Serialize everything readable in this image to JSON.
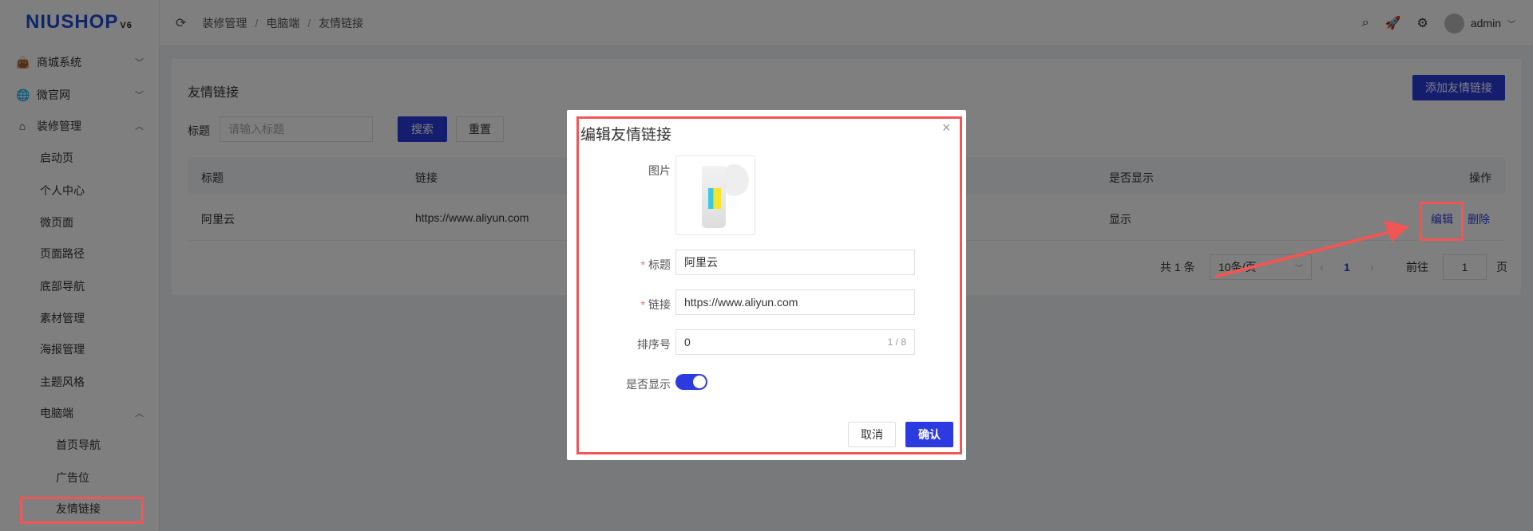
{
  "logo": {
    "text": "NIUSHOP",
    "version": "V6"
  },
  "sidebar": {
    "items": [
      {
        "label": "商城系统",
        "icon": "bag-icon",
        "expanded": false
      },
      {
        "label": "微官网",
        "icon": "globe-icon",
        "expanded": false
      },
      {
        "label": "装修管理",
        "icon": "decor-icon",
        "expanded": true
      },
      {
        "label": "启动页"
      },
      {
        "label": "个人中心"
      },
      {
        "label": "微页面"
      },
      {
        "label": "页面路径"
      },
      {
        "label": "底部导航"
      },
      {
        "label": "素材管理"
      },
      {
        "label": "海报管理"
      },
      {
        "label": "主题风格"
      },
      {
        "label": "电脑端",
        "expanded": true
      },
      {
        "label": "首页导航"
      },
      {
        "label": "广告位"
      },
      {
        "label": "友情链接",
        "active": true
      }
    ]
  },
  "header": {
    "breadcrumb": [
      "装修管理",
      "电脑端",
      "友情链接"
    ],
    "separator": "/",
    "user": "admin"
  },
  "page": {
    "title": "友情链接",
    "add_button": "添加友情链接",
    "search": {
      "label": "标题",
      "placeholder": "请输入标题",
      "search_button": "搜索",
      "reset_button": "重置"
    },
    "table": {
      "columns": [
        "标题",
        "链接",
        "是否显示",
        "操作"
      ],
      "rows": [
        {
          "title": "阿里云",
          "link": "https://www.aliyun.com",
          "show": "显示",
          "actions": [
            "编辑",
            "删除"
          ]
        }
      ]
    },
    "pagination": {
      "total": "共 1 条",
      "page_size": "10条/页",
      "current": "1",
      "goto_label": "前往",
      "goto_value": "1",
      "page_suffix": "页"
    }
  },
  "modal": {
    "title": "编辑友情链接",
    "image_label": "图片",
    "title_label": "标题",
    "title_value": "阿里云",
    "link_label": "链接",
    "link_value": "https://www.aliyun.com",
    "sort_label": "排序号",
    "sort_value": "0",
    "sort_counter": "1 / 8",
    "show_label": "是否显示",
    "show_on": true,
    "cancel": "取消",
    "confirm": "确认"
  },
  "colors": {
    "primary": "#2b3bdf",
    "annotation": "#f25555"
  }
}
